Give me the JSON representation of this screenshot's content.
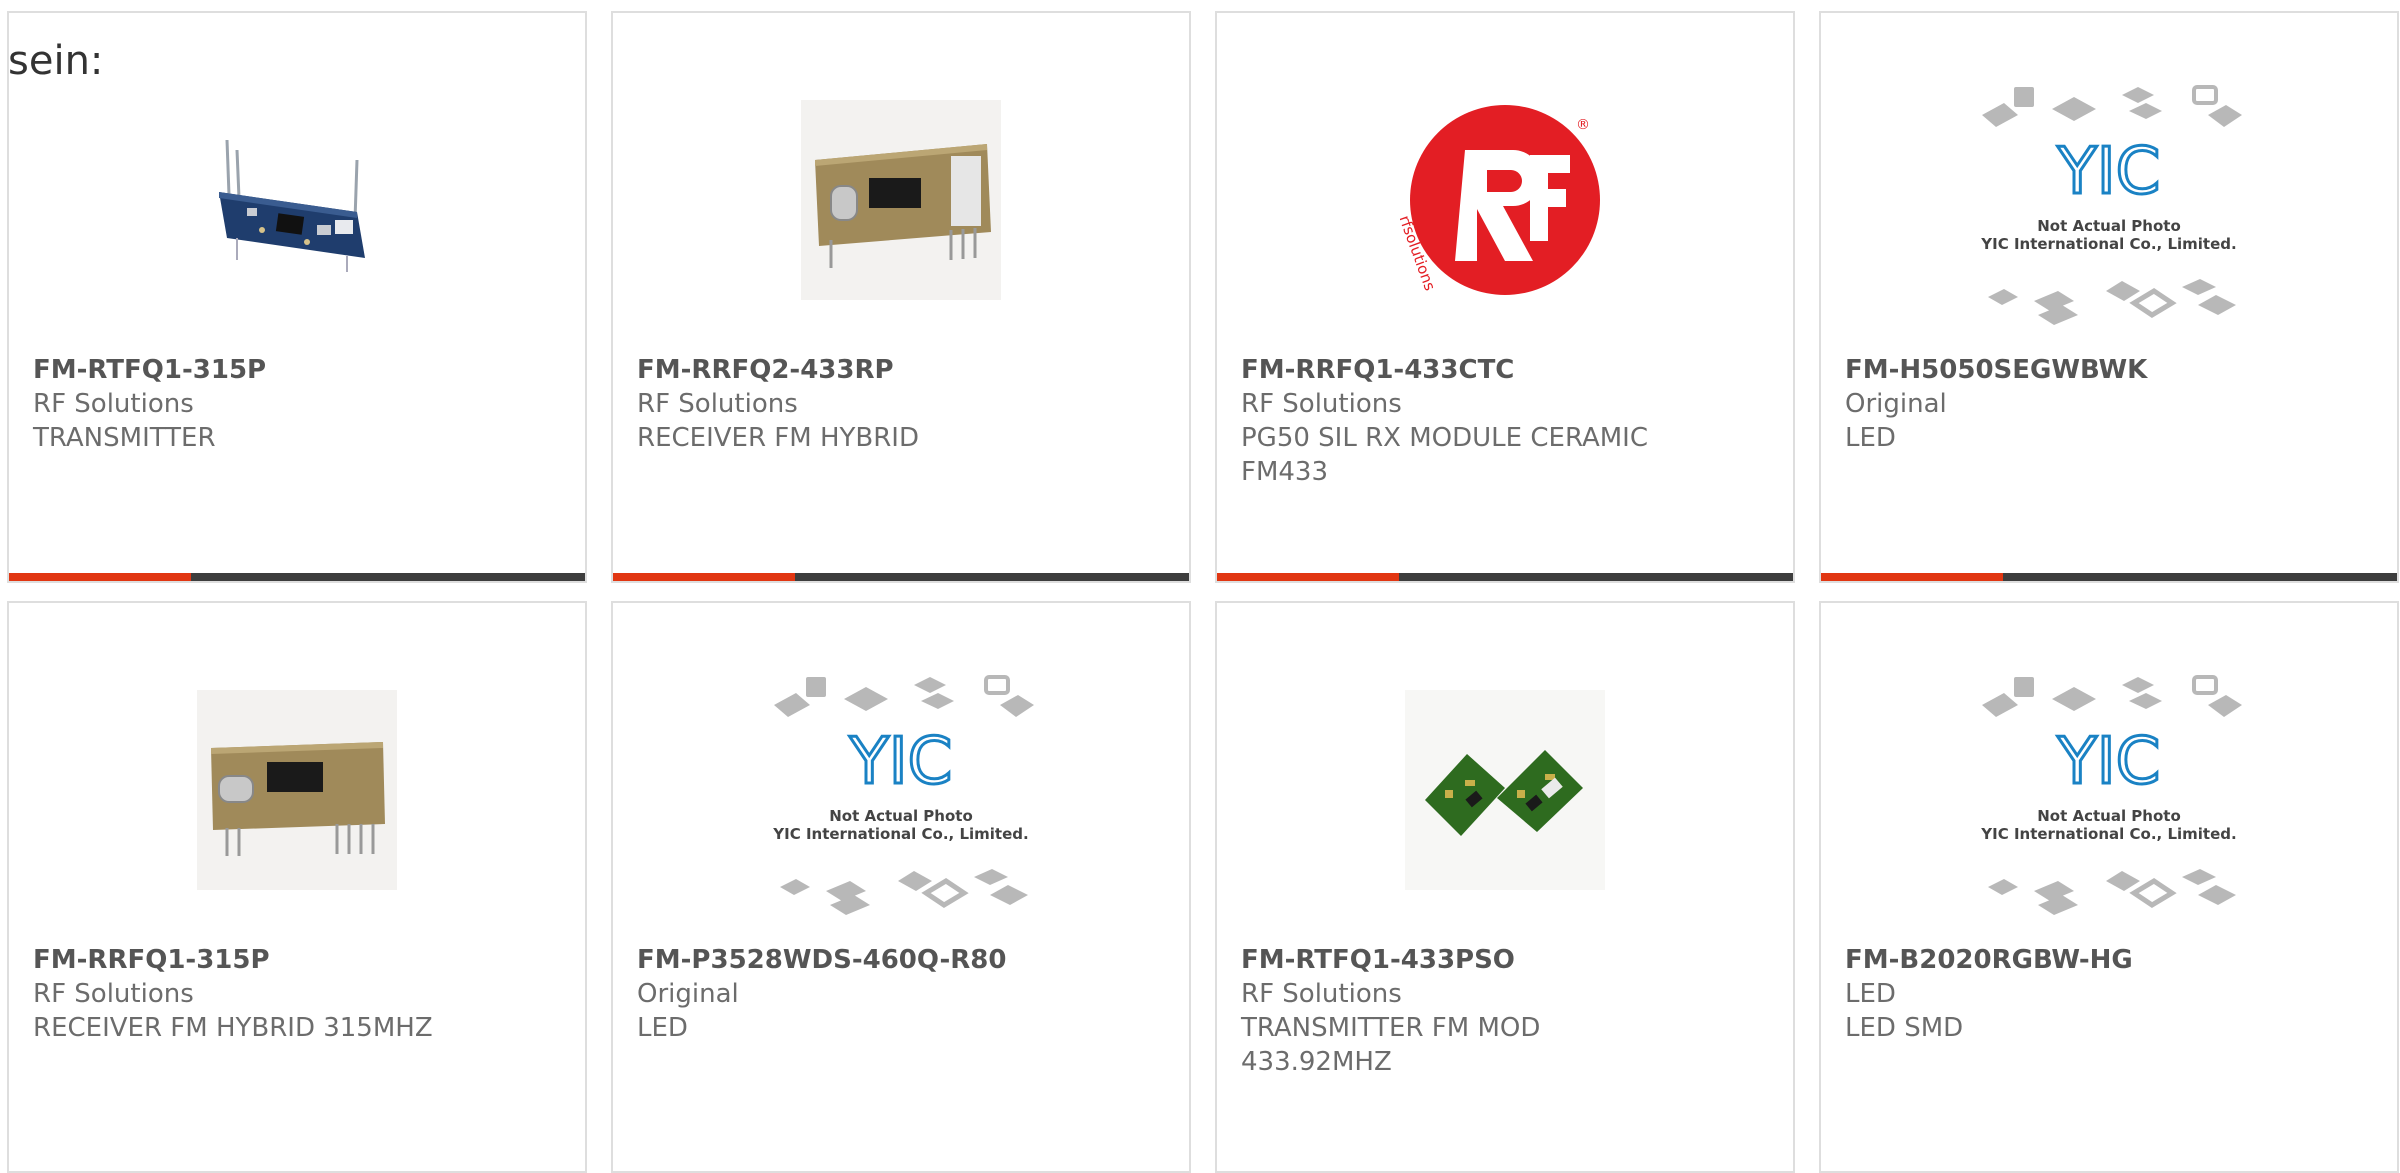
{
  "intro_text": "sein:",
  "products": [
    {
      "part": "FM-RTFQ1-315P",
      "maker": "RF Solutions",
      "desc": [
        "TRANSMITTER"
      ],
      "image": "transmitter-pcb-photo"
    },
    {
      "part": "FM-RRFQ2-433RP",
      "maker": "RF Solutions",
      "desc": [
        "RECEIVER FM HYBRID"
      ],
      "image": "receiver-module-photo"
    },
    {
      "part": "FM-RRFQ1-433CTC",
      "maker": "RF Solutions",
      "desc": [
        "PG50 SIL RX MODULE CERAMIC",
        "FM433"
      ],
      "image": "rf-solutions-logo"
    },
    {
      "part": "FM-H5050SEGWBWK",
      "maker": "Original",
      "desc": [
        "LED"
      ],
      "image": "yic-placeholder"
    },
    {
      "part": "FM-RRFQ1-315P",
      "maker": "RF Solutions",
      "desc": [
        "RECEIVER FM HYBRID 315MHZ"
      ],
      "image": "receiver-module-photo"
    },
    {
      "part": "FM-P3528WDS-460Q-R80",
      "maker": "Original",
      "desc": [
        "LED"
      ],
      "image": "yic-placeholder"
    },
    {
      "part": "FM-RTFQ1-433PSO",
      "maker": "RF Solutions",
      "desc": [
        "TRANSMITTER FM MOD",
        "433.92MHZ"
      ],
      "image": "green-pcb-photo"
    },
    {
      "part": "FM-B2020RGBW-HG",
      "maker": "LED",
      "desc": [
        "LED SMD"
      ],
      "image": "yic-placeholder"
    }
  ],
  "placeholder": {
    "logo_text": "YIC",
    "line1": "Not Actual Photo",
    "line2": "YIC International Co., Limited."
  },
  "colors": {
    "accent": "#e13612",
    "bar_dark": "#3d3d3d",
    "card_border": "#dedede",
    "text": "#6c6c6c"
  }
}
